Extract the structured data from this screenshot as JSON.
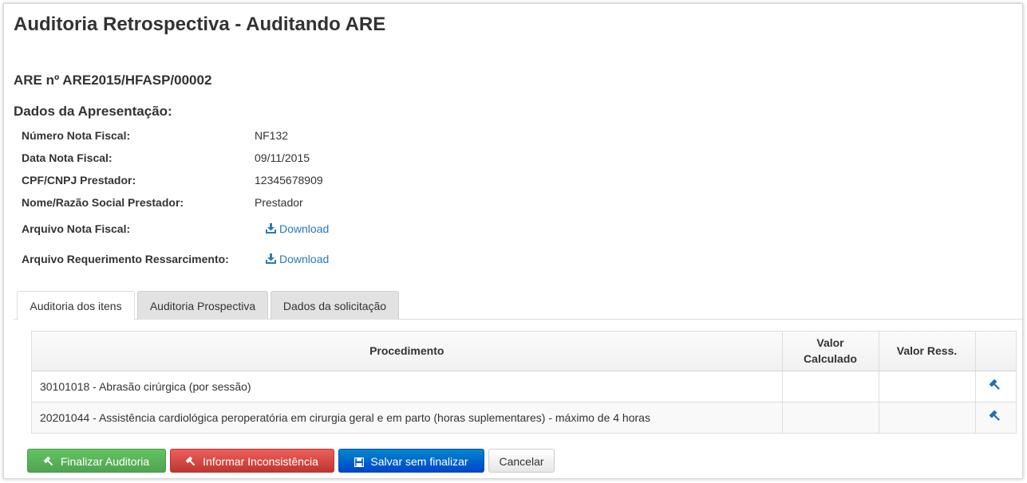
{
  "header": {
    "page_title": "Auditoria Retrospectiva - Auditando ARE",
    "are_number": "ARE nº ARE2015/HFASP/00002",
    "section_title": "Dados da Apresentação:"
  },
  "details": [
    {
      "label": "Número Nota Fiscal:",
      "value": "NF132"
    },
    {
      "label": "Data Nota Fiscal:",
      "value": "09/11/2015"
    },
    {
      "label": "CPF/CNPJ Prestador:",
      "value": "12345678909"
    },
    {
      "label": "Nome/Razão Social Prestador:",
      "value": "Prestador"
    }
  ],
  "files": [
    {
      "label": "Arquivo Nota Fiscal:",
      "link": "Download",
      "icon": "download-icon"
    },
    {
      "label": "Arquivo Requerimento Ressarcimento:",
      "link": "Download",
      "icon": "download-icon"
    }
  ],
  "tabs": [
    {
      "label": "Auditoria dos itens",
      "active": true
    },
    {
      "label": "Auditoria Prospectiva",
      "active": false
    },
    {
      "label": "Dados da solicitação",
      "active": false
    }
  ],
  "table": {
    "columns": [
      "Procedimento",
      "Valor Calculado",
      "Valor Ress.",
      ""
    ],
    "rows": [
      {
        "procedimento": "30101018 - Abrasão cirúrgica (por sessão)",
        "valor_calculado": "",
        "valor_ress": "",
        "action_icon": "gavel-icon"
      },
      {
        "procedimento": "20201044 - Assistência cardiológica peroperatória em cirurgia geral e em parto (horas suplementares) - máximo de 4 horas",
        "valor_calculado": "",
        "valor_ress": "",
        "action_icon": "gavel-icon"
      }
    ]
  },
  "actions": {
    "finalize_label": "Finalizar Auditoria",
    "inconsistency_label": "Informar Inconsistência",
    "save_label": "Salvar sem finalizar",
    "cancel_label": "Cancelar"
  },
  "colors": {
    "link": "#2a7ab8",
    "green": "#5bb75b",
    "red": "#da4f49",
    "blue": "#006dcc"
  }
}
